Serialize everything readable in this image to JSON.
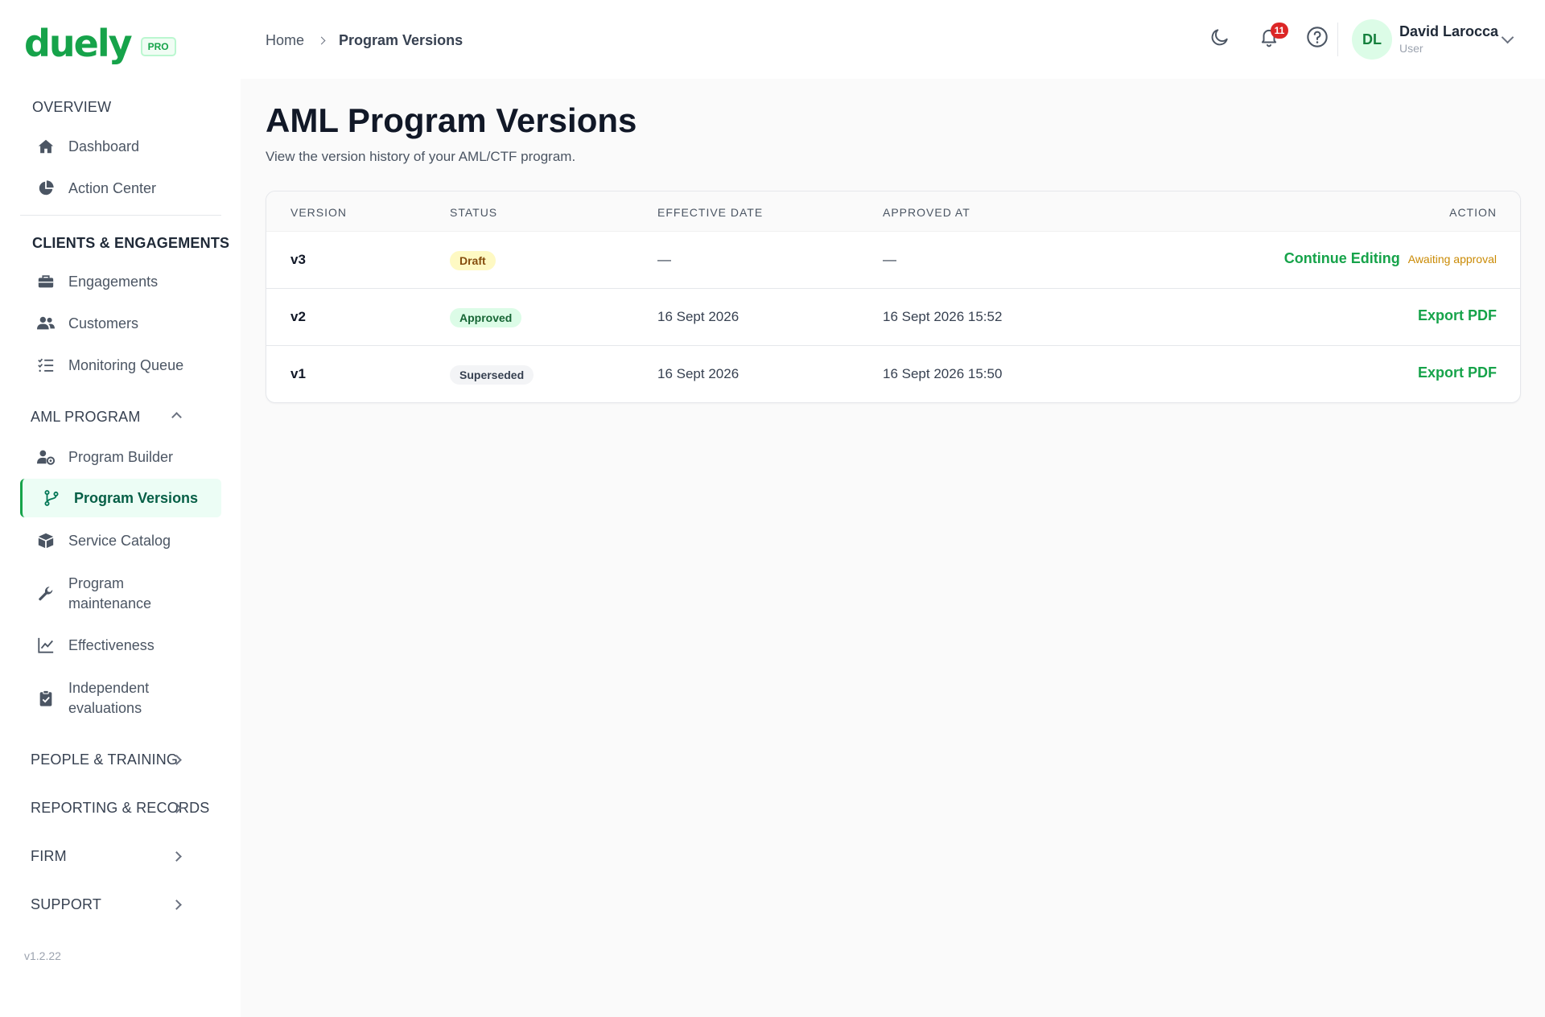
{
  "app": {
    "logo_text": "duely",
    "plan_badge": "PRO",
    "version": "v1.2.22"
  },
  "sidebar": {
    "overview": {
      "title": "OVERVIEW",
      "items": [
        {
          "label": "Dashboard"
        },
        {
          "label": "Action Center"
        }
      ]
    },
    "clients": {
      "title": "CLIENTS & ENGAGEMENTS",
      "items": [
        {
          "label": "Engagements"
        },
        {
          "label": "Customers"
        },
        {
          "label": "Monitoring Queue"
        }
      ]
    },
    "aml": {
      "title": "AML PROGRAM",
      "items": [
        {
          "label": "Program Builder"
        },
        {
          "label": "Program Versions"
        },
        {
          "label": "Service Catalog"
        },
        {
          "label": "Program maintenance"
        },
        {
          "label": "Effectiveness"
        },
        {
          "label": "Independent evaluations"
        }
      ]
    },
    "collapsed_sections": [
      "PEOPLE & TRAINING",
      "REPORTING & RECORDS",
      "FIRM",
      "SUPPORT"
    ]
  },
  "header": {
    "breadcrumb": {
      "home": "Home",
      "current": "Program Versions"
    },
    "notifications_count": "11",
    "user": {
      "initials": "DL",
      "name": "David Larocca",
      "role": "User"
    }
  },
  "main": {
    "title": "AML Program Versions",
    "subtitle": "View the version history of your AML/CTF program.",
    "table": {
      "columns": [
        "VERSION",
        "STATUS",
        "EFFECTIVE DATE",
        "APPROVED AT",
        "ACTION"
      ],
      "rows": [
        {
          "version": "v3",
          "status": "Draft",
          "effective_date": "—",
          "approved_at": "—",
          "action": "Continue Editing",
          "note": "Awaiting approval"
        },
        {
          "version": "v2",
          "status": "Approved",
          "effective_date": "16 Sept 2026",
          "approved_at": "16 Sept 2026 15:52",
          "action": "Export PDF"
        },
        {
          "version": "v1",
          "status": "Superseded",
          "effective_date": "16 Sept 2026",
          "approved_at": "16 Sept 2026 15:50",
          "action": "Export PDF"
        }
      ]
    }
  },
  "colors": {
    "brand": "#16a34a",
    "draft_badge": "#fef9c3",
    "approved_badge": "#dcfce7",
    "notification": "#dc2626"
  }
}
